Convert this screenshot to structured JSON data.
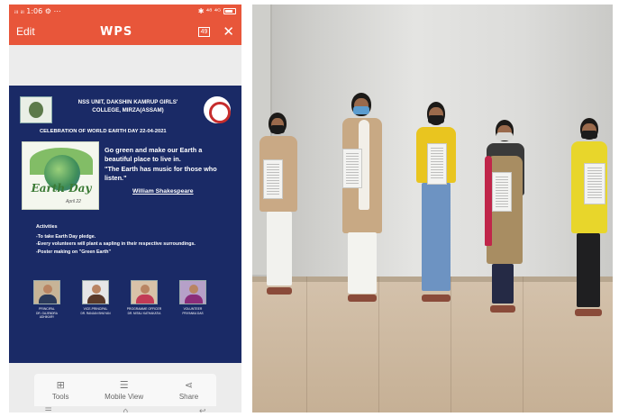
{
  "status_bar": {
    "time": "1:06",
    "left_icons": "ᵢₗₗ ᵢₗₗ",
    "extras": "⚙ ⋯",
    "right": "✱ ⁴⁸ ⁴ᴳ"
  },
  "toolbar": {
    "edit_label": "Edit",
    "app_logo": "WPS",
    "page_indicator": "49",
    "close_icon": "✕"
  },
  "document": {
    "institution_line1": "NSS UNIT, DAKSHIN KAMRUP GIRLS'",
    "institution_line2": "COLLEGE, MIRZA(ASSAM)",
    "celebration": "CELEBRATION OF WORLD EARTH DAY 22-04-2021",
    "earth_day_text": "Earth Day",
    "earth_day_date": "April 22",
    "slogan": "Go green and make our Earth a beautiful place to live in.",
    "quote": "\"The Earth has music for those who listen.\"",
    "author": "William Shakespeare",
    "activities_heading": "Activities",
    "activities": [
      "-To take Earth Day pledge.",
      "-Every volunteers will plant a sapling in their respective surroundings.",
      "-Poster making on \"Green Earth\""
    ],
    "people": [
      {
        "role": "PRINCIPAL",
        "name": "DR. GAJENDRA ADHIKARY"
      },
      {
        "role": "VICE-PRINCIPAL",
        "name": "DR. RANJAN BHUYAN"
      },
      {
        "role": "PROGRAMME OFFICER",
        "name": "DR. MITALI KATHAKATIA"
      },
      {
        "role": "VOLUNTEER",
        "name": "PRIYANKA DAS"
      }
    ]
  },
  "bottom_bar": {
    "tools_label": "Tools",
    "mobile_view_label": "Mobile View",
    "share_label": "Share",
    "tools_icon": "grid-icon",
    "mobile_view_icon": "document-view-icon",
    "share_icon": "share-icon"
  },
  "nav": {
    "menu_icon": "☰",
    "home_icon": "⌂",
    "back_icon": "↩"
  },
  "colors": {
    "accent": "#e8563a",
    "document_bg": "#1a2a66"
  }
}
